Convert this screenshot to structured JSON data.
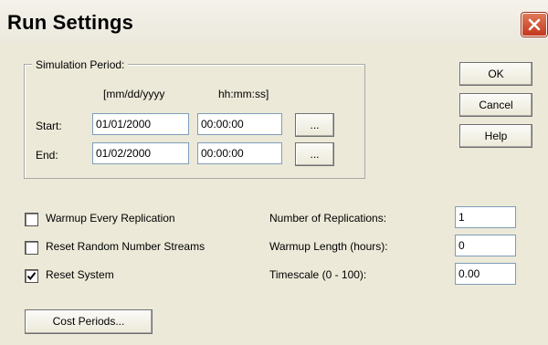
{
  "window": {
    "title": "Run Settings",
    "close_icon": "close-icon"
  },
  "simulation_period": {
    "legend": "Simulation Period:",
    "date_header": "[mm/dd/yyyy",
    "time_header": "hh:mm:ss]",
    "start": {
      "label": "Start:",
      "date": "01/01/2000",
      "time": "00:00:00",
      "browse": "..."
    },
    "end": {
      "label": "End:",
      "date": "01/02/2000",
      "time": "00:00:00",
      "browse": "..."
    }
  },
  "buttons": {
    "ok": "OK",
    "cancel": "Cancel",
    "help": "Help",
    "cost_periods": "Cost Periods..."
  },
  "options": [
    {
      "label": "Warmup Every Replication",
      "checked": false
    },
    {
      "label": "Reset Random Number Streams",
      "checked": false
    },
    {
      "label": "Reset System",
      "checked": true
    }
  ],
  "parameters": [
    {
      "label": "Number of Replications:",
      "value": "1"
    },
    {
      "label": "Warmup Length (hours):",
      "value": "0"
    },
    {
      "label": "Timescale (0 - 100):",
      "value": "0.00"
    }
  ]
}
